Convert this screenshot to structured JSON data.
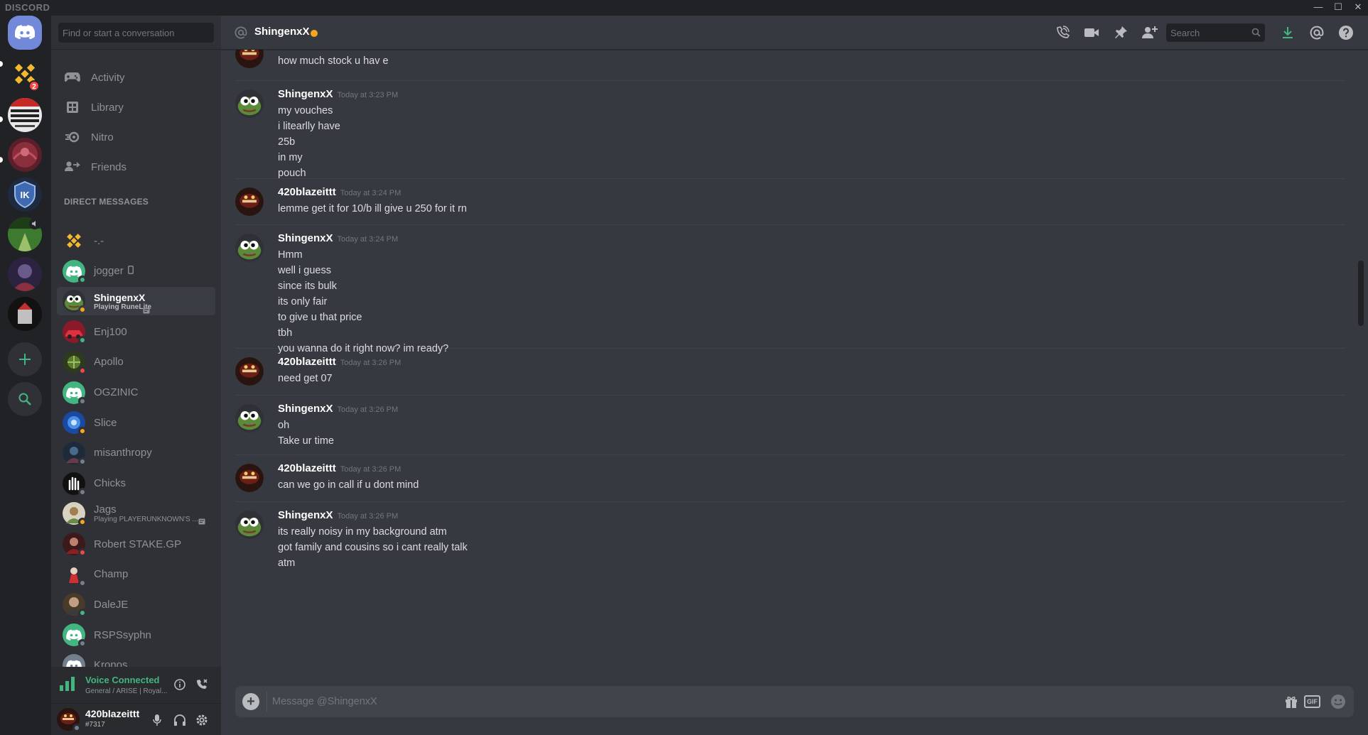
{
  "app": {
    "brand": "DISCORD",
    "win_min": "—",
    "win_max": "☐",
    "win_close": "✕"
  },
  "servers": {
    "binance_badge": "2"
  },
  "sidebar": {
    "search_placeholder": "Find or start a conversation",
    "nav": [
      {
        "label": "Activity",
        "icon": "gamepad-icon"
      },
      {
        "label": "Library",
        "icon": "library-icon"
      },
      {
        "label": "Nitro",
        "icon": "nitro-icon"
      },
      {
        "label": "Friends",
        "icon": "friends-icon"
      }
    ],
    "dm_header": "DIRECT MESSAGES",
    "dms": [
      {
        "name": "-.-",
        "sub": "",
        "status": ""
      },
      {
        "name": "jogger",
        "sub": "",
        "status": "online",
        "mobile": true
      },
      {
        "name": "ShingenxX",
        "sub": "Playing RuneLite",
        "status": "idle"
      },
      {
        "name": "Enj100",
        "sub": "",
        "status": "online"
      },
      {
        "name": "Apollo",
        "sub": "",
        "status": "dnd"
      },
      {
        "name": "OGZINIC",
        "sub": "",
        "status": "offline"
      },
      {
        "name": "Slice",
        "sub": "",
        "status": "idle"
      },
      {
        "name": "misanthropy",
        "sub": "",
        "status": "offline"
      },
      {
        "name": "Chicks",
        "sub": "",
        "status": "offline"
      },
      {
        "name": "Jags",
        "sub": "Playing PLAYERUNKNOWN'S ...",
        "status": "idle"
      },
      {
        "name": "Robert STAKE.GP",
        "sub": "",
        "status": "dnd"
      },
      {
        "name": "Champ",
        "sub": "",
        "status": "offline"
      },
      {
        "name": "DaleJE",
        "sub": "",
        "status": "online"
      },
      {
        "name": "RSPSsyphn",
        "sub": "",
        "status": "offline"
      },
      {
        "name": "Kronos",
        "sub": "",
        "status": "offline"
      }
    ],
    "voice": {
      "title": "Voice Connected",
      "sub": "General / ARISE | Royal..."
    },
    "user": {
      "name": "420blazeittt",
      "tag": "#7317"
    }
  },
  "header": {
    "name": "ShingenxX",
    "search_placeholder": "Search"
  },
  "messages": [
    {
      "author": "",
      "time": "",
      "lines": [
        "how much stock u hav e"
      ],
      "avatar": "blaze"
    },
    {
      "author": "ShingenxX",
      "time": "Today at 3:23 PM",
      "lines": [
        "my vouches",
        "i litearlly have",
        "25b",
        "in my",
        "pouch"
      ],
      "avatar": "pepe"
    },
    {
      "author": "420blazeittt",
      "time": "Today at 3:24 PM",
      "lines": [
        "lemme get it for 10/b ill give u 250 for it rn"
      ],
      "avatar": "blaze"
    },
    {
      "author": "ShingenxX",
      "time": "Today at 3:24 PM",
      "lines": [
        "Hmm",
        "well i guess",
        "since its bulk",
        "its only fair",
        "to give u that price",
        "tbh",
        "you wanna do it right now? im ready?"
      ],
      "avatar": "pepe"
    },
    {
      "author": "420blazeittt",
      "time": "Today at 3:26 PM",
      "lines": [
        "need get 07"
      ],
      "avatar": "blaze"
    },
    {
      "author": "ShingenxX",
      "time": "Today at 3:26 PM",
      "lines": [
        "oh",
        "Take ur time"
      ],
      "avatar": "pepe"
    },
    {
      "author": "420blazeittt",
      "time": "Today at 3:26 PM",
      "lines": [
        "can we go in call if u dont mind"
      ],
      "avatar": "blaze"
    },
    {
      "author": "ShingenxX",
      "time": "Today at 3:26 PM",
      "lines": [
        "its really noisy in my background atm",
        "got family and cousins so i cant really talk",
        "atm"
      ],
      "avatar": "pepe"
    }
  ],
  "composer": {
    "placeholder": "Message @ShingenxX",
    "gif_label": "GIF",
    "add_label": "+"
  },
  "colors": {
    "online": "#43b581",
    "idle": "#faa61a",
    "dnd": "#f04747",
    "offline": "#747f8d",
    "accent": "#7289da"
  }
}
